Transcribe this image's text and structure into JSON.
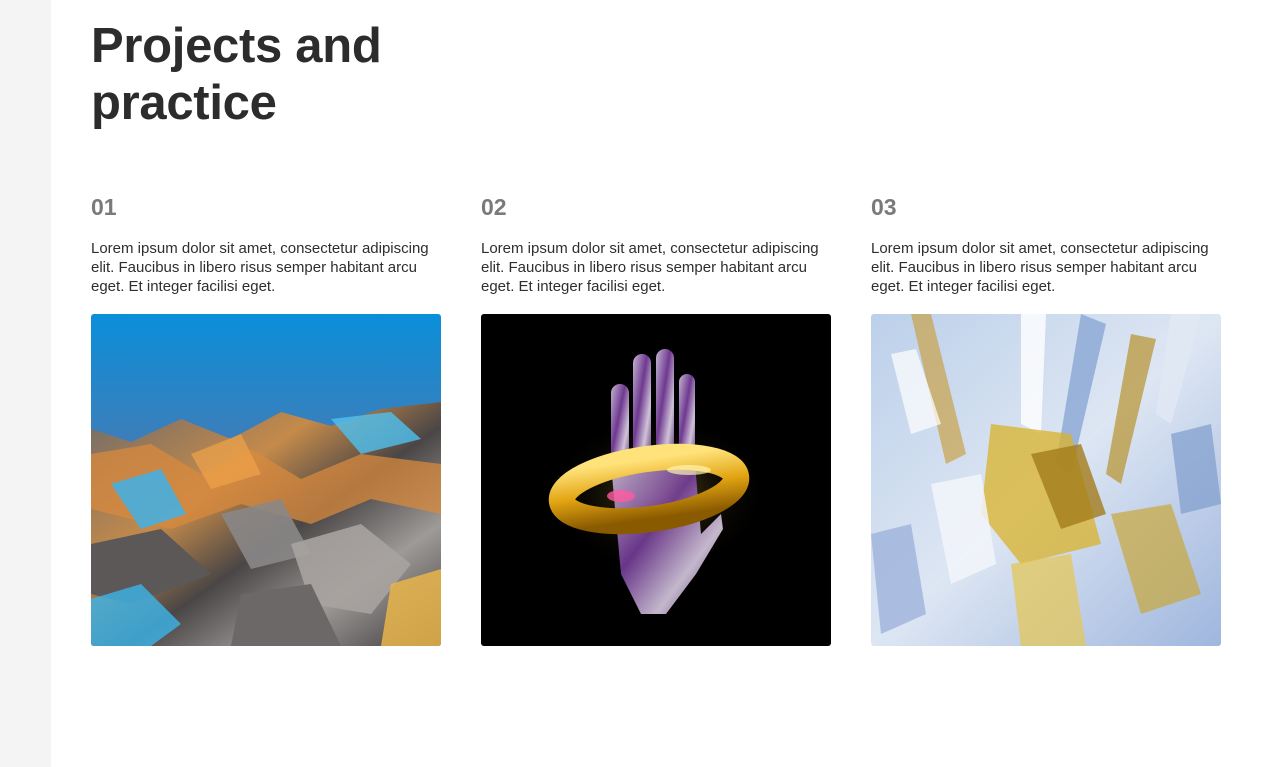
{
  "page": {
    "title_line1": "Projects and",
    "title_line2": "practice"
  },
  "projects": [
    {
      "number": "01",
      "description": "Lorem ipsum dolor sit amet, consectetur adipiscing elit. Faucibus in libero risus semper habitant arcu eget. Et integer facilisi eget."
    },
    {
      "number": "02",
      "description": "Lorem ipsum dolor sit amet, consectetur adipiscing elit. Faucibus in libero risus semper habitant arcu eget. Et integer facilisi eget."
    },
    {
      "number": "03",
      "description": "Lorem ipsum dolor sit amet, consectetur adipiscing elit. Faucibus in libero risus semper habitant arcu eget. Et integer facilisi eget."
    }
  ],
  "colors": {
    "heading": "#2c2c2c",
    "number": "#7a7a7a",
    "body_text": "#2e2e2e",
    "side_strip": "#f4f4f4"
  }
}
